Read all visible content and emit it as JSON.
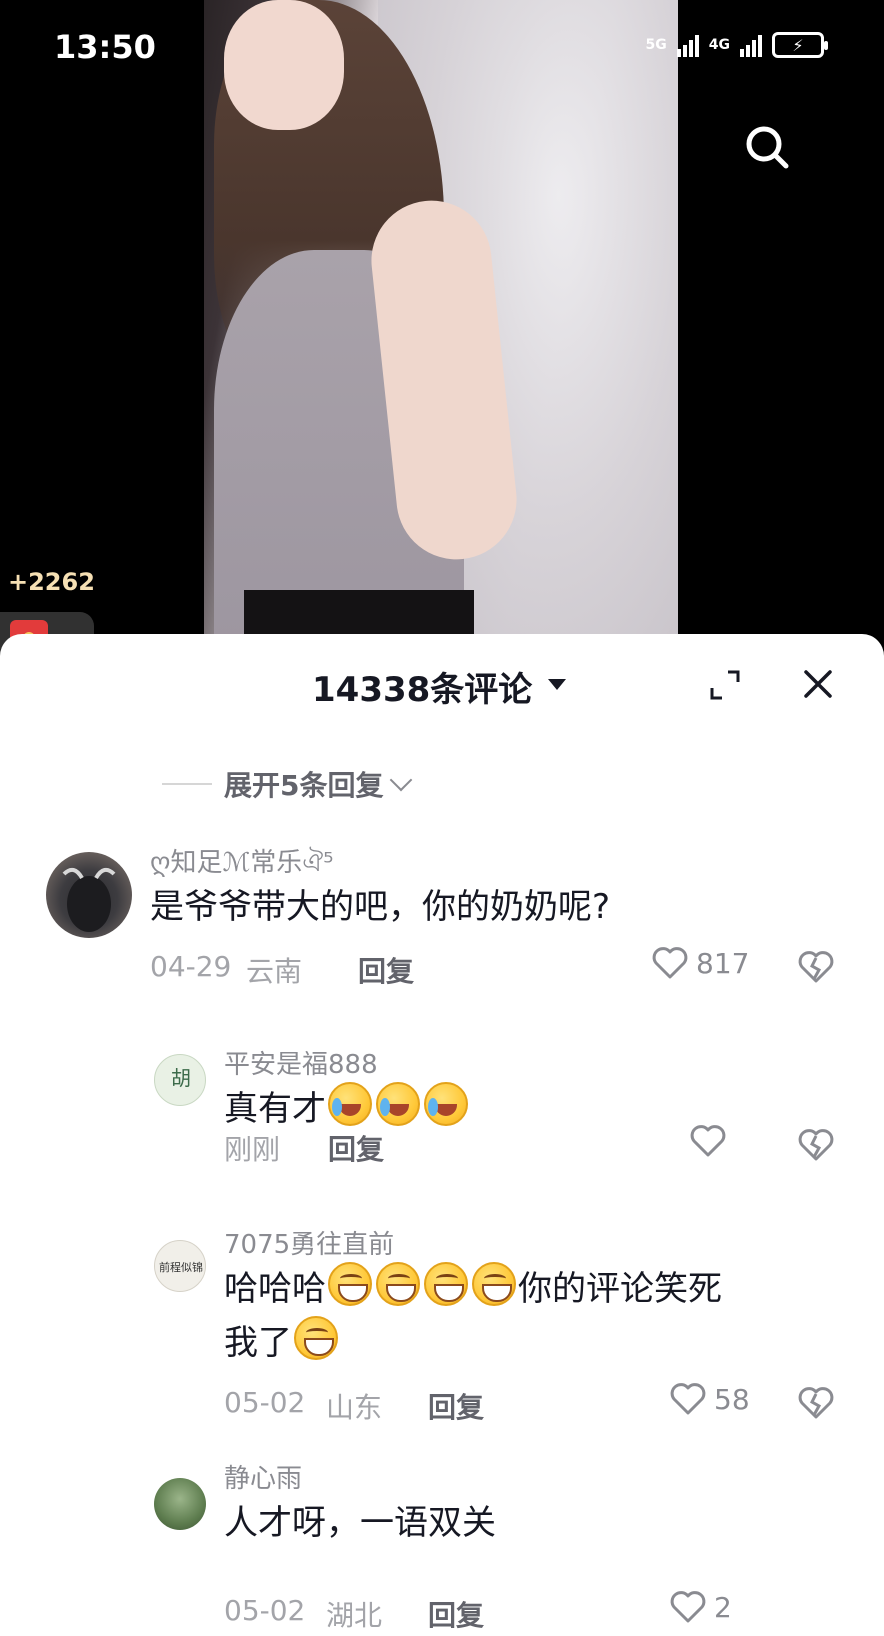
{
  "status_bar": {
    "time": "13:50",
    "signal_1_label": "5G",
    "signal_2_label": "4G",
    "battery_icon": "battery-charging-icon"
  },
  "video": {
    "coin_count": "+2262",
    "search_icon": "search-icon"
  },
  "comments_panel": {
    "title": "14338条评论",
    "expand_replies": "展开5条回复",
    "comments": [
      {
        "username": "ღ知足ℳ常乐ঐ⁵",
        "text": "是爷爷带大的吧，你的奶奶呢?",
        "date": "04-29",
        "location": "云南",
        "reply_label": "回复",
        "likes": "817"
      }
    ],
    "replies": [
      {
        "username": "平安是福888",
        "text": "真有才",
        "emojis": [
          "laugh",
          "laugh",
          "laugh"
        ],
        "date": "刚刚",
        "location": "",
        "reply_label": "回复",
        "likes": ""
      },
      {
        "username": "7075勇往直前",
        "text_before": "哈哈哈",
        "emojis_mid": [
          "grin",
          "grin",
          "grin",
          "grin"
        ],
        "text_after": "你的评论笑死",
        "text_line2": "我了",
        "emojis_end": [
          "grin"
        ],
        "date": "05-02",
        "location": "山东",
        "reply_label": "回复",
        "likes": "58"
      },
      {
        "username": "静心雨",
        "text": "人才呀，一语双关",
        "date": "05-02",
        "location": "湖北",
        "reply_label": "回复",
        "likes": "2"
      }
    ]
  }
}
